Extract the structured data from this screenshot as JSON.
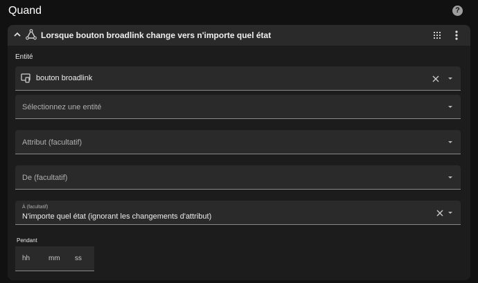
{
  "header": {
    "title": "Quand",
    "help_icon": "help-circle-icon"
  },
  "trigger": {
    "title": "Lorsque bouton broadlink change vers n'importe quel état",
    "collapse_icon": "chevron-up-icon",
    "type_icon": "state-trigger-icon",
    "drag_icon": "drag-handle-icon",
    "menu_icon": "more-vertical-icon"
  },
  "entity_section": {
    "label": "Entité",
    "selected_entity": {
      "icon": "remote-icon",
      "value": "bouton broadlink"
    },
    "entity_picker_placeholder": "Sélectionnez une entité"
  },
  "attribute_field": {
    "placeholder": "Attribut (facultatif)"
  },
  "from_field": {
    "placeholder": "De (facultatif)"
  },
  "to_field": {
    "label": "À (facultatif)",
    "value": "N'importe quel état (ignorant les changements d'attribut)"
  },
  "duration": {
    "label": "Pendant",
    "hours_placeholder": "hh",
    "minutes_placeholder": "mm",
    "seconds_placeholder": "ss"
  },
  "colors": {
    "background": "#111111",
    "card": "#1c1c1c",
    "field": "#2a2a2a",
    "text": "#e1e1e1"
  }
}
